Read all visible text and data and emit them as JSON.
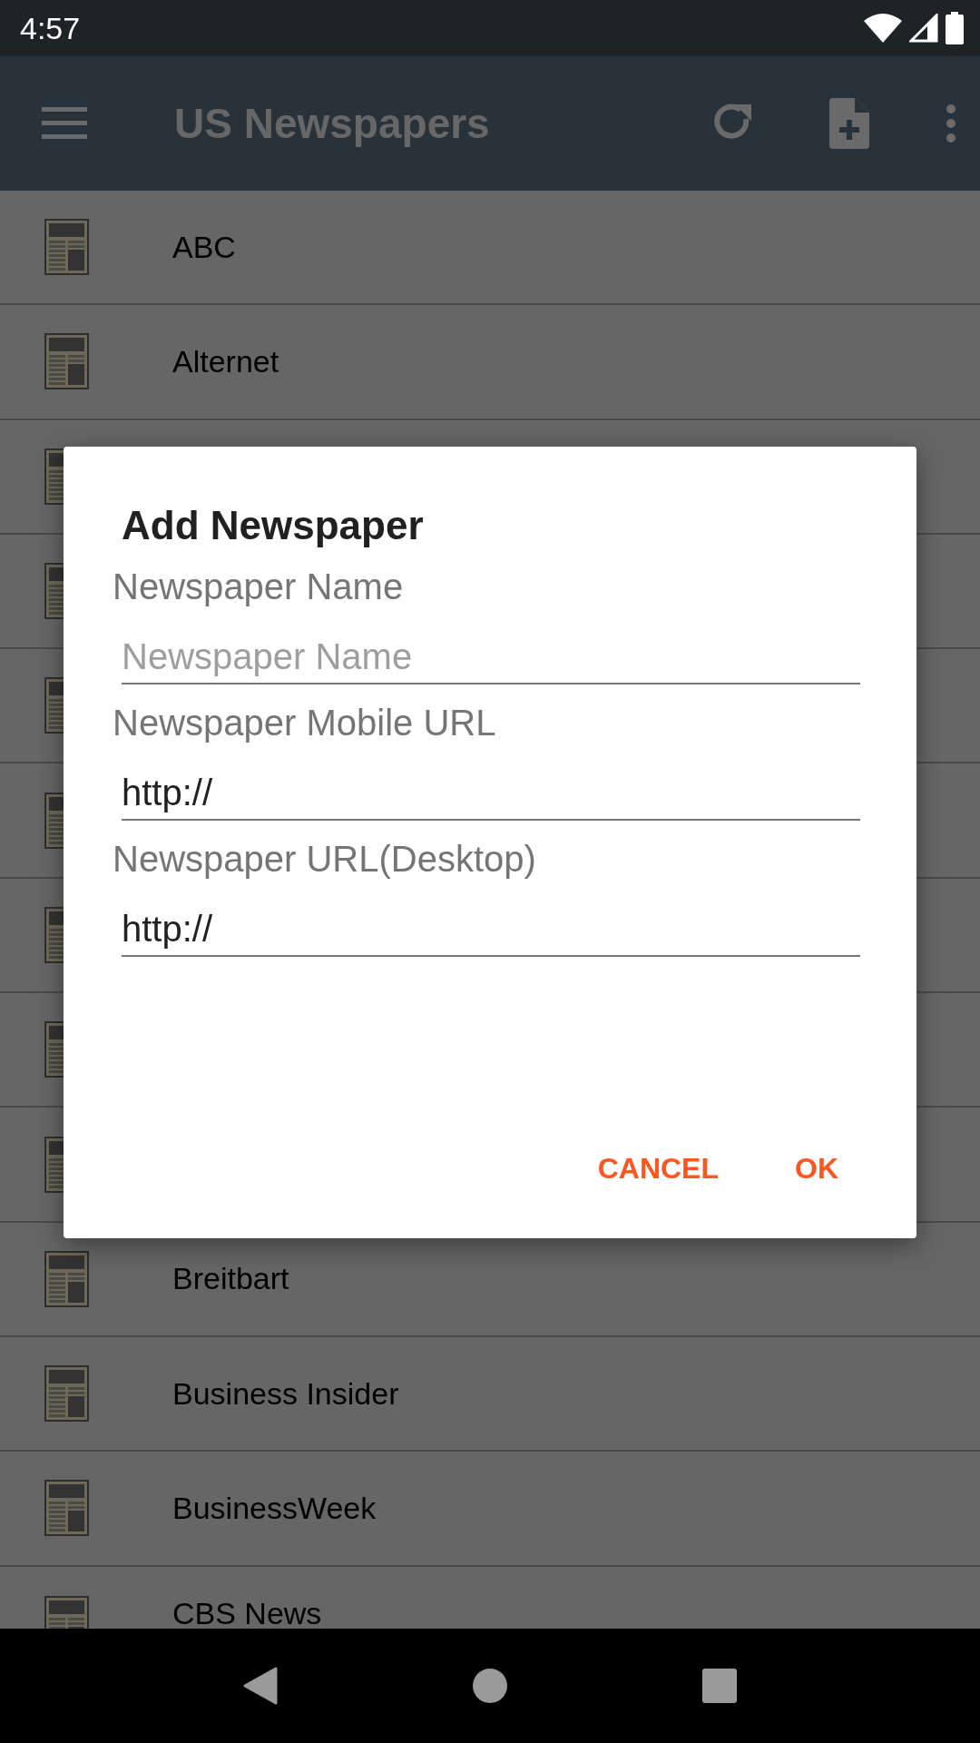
{
  "status_bar": {
    "time": "4:57"
  },
  "app_bar": {
    "title": "US Newspapers"
  },
  "list": [
    {
      "kind": "item",
      "name": "ABC"
    },
    {
      "kind": "item",
      "name": "Alternet"
    },
    {
      "kind": "covered"
    },
    {
      "kind": "covered"
    },
    {
      "kind": "covered"
    },
    {
      "kind": "covered"
    },
    {
      "kind": "covered"
    },
    {
      "kind": "covered"
    },
    {
      "kind": "covered"
    },
    {
      "kind": "item",
      "name": "Breitbart"
    },
    {
      "kind": "item",
      "name": "Business Insider"
    },
    {
      "kind": "item",
      "name": "BusinessWeek"
    },
    {
      "kind": "item",
      "name": "CBS News"
    }
  ],
  "dialog": {
    "title": "Add Newspaper",
    "fields": [
      {
        "label": "Newspaper Name",
        "placeholder": "Newspaper Name"
      },
      {
        "label": "Newspaper Mobile URL",
        "value": "http://"
      },
      {
        "label": "Newspaper URL(Desktop)",
        "value": "http://"
      }
    ],
    "buttons": [
      "CANCEL",
      "OK"
    ]
  }
}
